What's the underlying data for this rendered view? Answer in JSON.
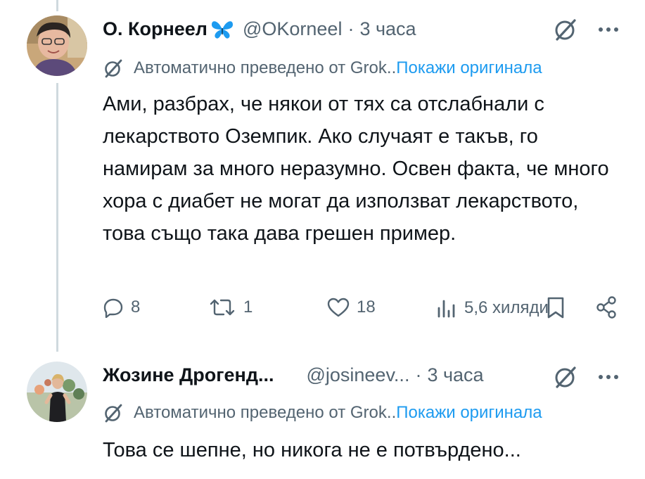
{
  "colors": {
    "text": "#0f1419",
    "muted": "#536471",
    "link": "#1d9bf0",
    "thread_line": "#cfd9de",
    "butterfly": "#1d9bf0"
  },
  "tweets": [
    {
      "author_name": "О. Корнеел",
      "name_badge_icon": "butterfly-icon",
      "handle": "@OKorneel",
      "separator": "·",
      "time": "3 часа",
      "translation_note": "Автоматично преведено от Grok..",
      "show_original": "Покажи оригинала",
      "text": "Ами, разбрах, че някои от тях са отслабнали с лекарството Оземпик. Ако случаят е такъв, го намирам за много неразумно. Освен факта, че много хора с диабет не могат да използват лекарството, това също така дава грешен пример.",
      "replies": "8",
      "reposts": "1",
      "likes": "18",
      "views": "5,6 хиляди"
    },
    {
      "author_name": "Жозине Дрогенд...",
      "handle": "@josineev...",
      "separator": "·",
      "time": "3 часа",
      "translation_note": "Автоматично преведено от Grok..",
      "show_original": "Покажи оригинала",
      "text": "Това се шепне, но никога не е потвърдено..."
    }
  ]
}
